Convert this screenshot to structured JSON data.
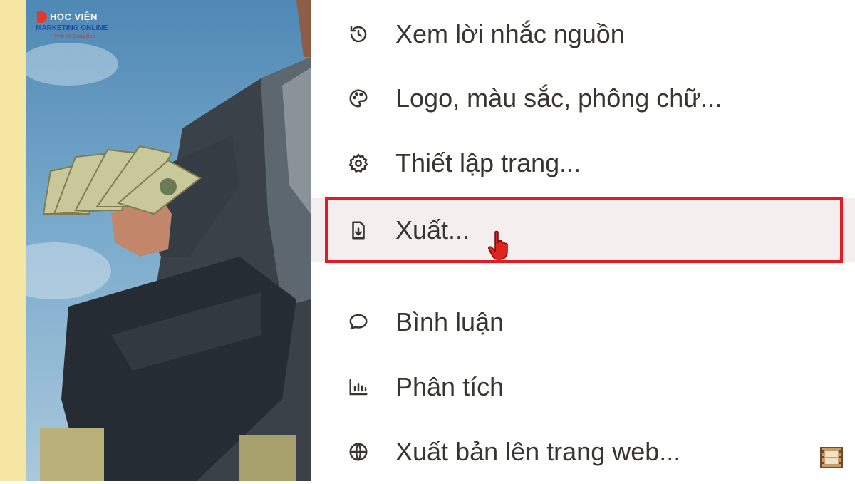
{
  "brand": {
    "line1": "HỌC VIỆN",
    "line2": "MARKETING ONLINE",
    "line3": "Vinh Xô Cùng Bạn"
  },
  "menu": {
    "items": [
      {
        "label": "Xem lời nhắc nguồn",
        "icon": "history-icon"
      },
      {
        "label": "Logo, màu sắc, phông chữ...",
        "icon": "palette-icon"
      },
      {
        "label": "Thiết lập trang...",
        "icon": "gear-icon"
      },
      {
        "label": "Xuất...",
        "icon": "file-download-icon",
        "highlighted": true
      },
      {
        "label": "Bình luận",
        "icon": "comment-icon"
      },
      {
        "label": "Phân tích",
        "icon": "bar-chart-icon"
      },
      {
        "label": "Xuất bản lên trang web...",
        "icon": "globe-icon"
      }
    ]
  },
  "colors": {
    "highlight_border": "#e31b23",
    "highlight_bg": "#f4eeee",
    "text": "#37352f"
  }
}
